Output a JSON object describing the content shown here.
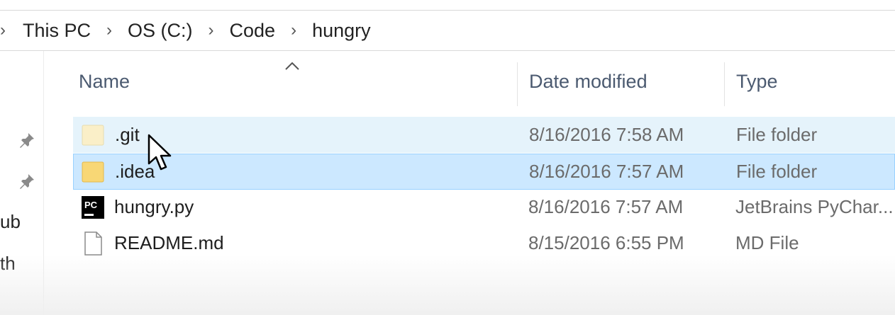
{
  "breadcrumb": {
    "segments": [
      "This PC",
      "OS (C:)",
      "Code",
      "hungry"
    ],
    "separator": "›"
  },
  "nav": {
    "labels": [
      "ub",
      "th"
    ]
  },
  "columns": {
    "name": "Name",
    "date": "Date modified",
    "type": "Type"
  },
  "files": [
    {
      "name": ".git",
      "date": "8/16/2016 7:58 AM",
      "type": "File folder",
      "icon": "folder-icon",
      "state": "hover"
    },
    {
      "name": ".idea",
      "date": "8/16/2016 7:57 AM",
      "type": "File folder",
      "icon": "folder-icon",
      "state": "selected"
    },
    {
      "name": "hungry.py",
      "date": "8/16/2016 7:57 AM",
      "type": "JetBrains PyChar...",
      "icon": "pycharm-file-icon",
      "state": "normal"
    },
    {
      "name": "README.md",
      "date": "8/15/2016 6:55 PM",
      "type": "MD File",
      "icon": "document-icon",
      "state": "normal"
    }
  ],
  "colors": {
    "selection": "#cce8ff",
    "selection_border": "#99d1ff",
    "hover": "#e5f3fb",
    "folder": "#f8d775"
  }
}
